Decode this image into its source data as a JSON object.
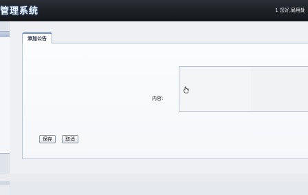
{
  "header": {
    "app_title": "管理系统",
    "greeting_number": "1",
    "greeting_text": "您好,",
    "username": "局用处"
  },
  "tabs": [
    {
      "label": "添加公告"
    }
  ],
  "form": {
    "content_label": "内容:",
    "save_label": "保存",
    "cancel_label": "取消"
  }
}
